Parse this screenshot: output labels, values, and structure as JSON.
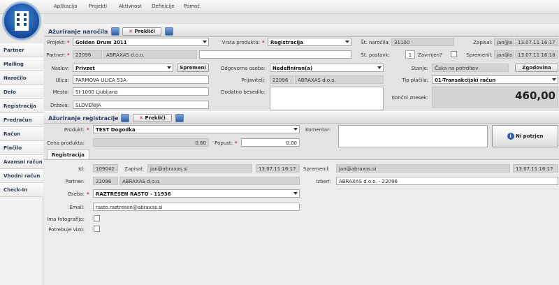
{
  "menu": [
    "Aplikacija",
    "Projekti",
    "Aktivnost",
    "Definicije",
    "Pomoč"
  ],
  "sidebar": [
    "Partner",
    "Mailing",
    "Naročilo",
    "Delo",
    "Registracija",
    "Predračun",
    "Račun",
    "Plačilo",
    "Avansni račun",
    "Vhodni račun",
    "Check-In"
  ],
  "order": {
    "title": "Ažuriranje naročila",
    "cancel_label": "Prekliči",
    "projekt_label": "Projekt:",
    "projekt_value": "Golden Drum 2011",
    "vrsta_label": "Vrsta produkta:",
    "vrsta_value": "Registracija",
    "st_narocila_label": "Št. naročila:",
    "st_narocila_value": "31100",
    "zapisal_label": "Zapisal:",
    "zapisal_value": "jan@a",
    "zapisal_date": "13.07.11 16:17",
    "partner_label": "Partner:",
    "partner_id": "22096",
    "partner_name": "ABRAXAS d.o.o.",
    "st_postavk_label": "Št. postavk:",
    "st_postavk_value": "1",
    "zavrnjen_label": "Zavrnjen?",
    "spremenil_label": "Spremenil:",
    "spremenil_value": "jan@a",
    "spremenil_date": "13.07.11 16:18",
    "naslov_label": "Naslov:",
    "naslov_value": "Privzet",
    "spremeni_label": "Spremeni",
    "odgovorna_label": "Odgovorna oseba:",
    "odgovorna_value": "Nedefiniran(a)",
    "stanje_label": "Stanje:",
    "stanje_value": "Čaka na potrditev",
    "zgodovina_label": "Zgodovina",
    "ulica_label": "Ulica:",
    "ulica_value": "PARMOVA ULICA 53A",
    "prijavitelj_label": "Prijavitelj:",
    "prijavitelj_id": "22096",
    "prijavitelj_name": "ABRAXAS d.o.o.",
    "tip_label": "Tip plačila:",
    "tip_value": "01-Transakcijski račun",
    "mesto_label": "Mesto:",
    "mesto_value": "SI-1000 Ljubljana",
    "dodatno_label": "Dodatno besedilo:",
    "koncni_label": "Končni znesek:",
    "koncni_value": "460,00",
    "drzava_label": "Država:",
    "drzava_value": "SLOVENIJA"
  },
  "reg": {
    "title": "Ažuriranje registracije",
    "cancel_label": "Prekliči",
    "produkt_label": "Produkt:",
    "produkt_value": "TEST Dogodka",
    "komentar_label": "Komentar:",
    "ni_potrjen_label": "Ni potrjen",
    "cena_label": "Cena produkta:",
    "cena_value": "0,60",
    "popust_label": "Popust:",
    "popust_value": "0,00",
    "tab_label": "Registracija",
    "id_label": "Id:",
    "id_value": "109042",
    "zapisal_label": "Zapisal:",
    "zapisal_value": "jan@abraxas.si",
    "zapisal_date": "13.07.11 16:17",
    "spremenil_label": "Spremenil:",
    "spremenil_value": "jan@abraxas.si",
    "spremenil_date": "13.07.11 16:17",
    "partner_label": "Partner:",
    "partner_id": "22096",
    "partner_name": "ABRAXAS d.o.o.",
    "izberi_label": "Izberi:",
    "izberi_value": "ABRAXAS d.o.o. - 22096",
    "oseba_label": "Oseba:",
    "oseba_value": "RAZTRESEN RASTO - 11936",
    "email_label": "Email:",
    "email_value": "rasto.raztresen@abraxas.si",
    "foto_label": "Ima fotografijo:",
    "vizo_label": "Potrebuje vizo:"
  }
}
